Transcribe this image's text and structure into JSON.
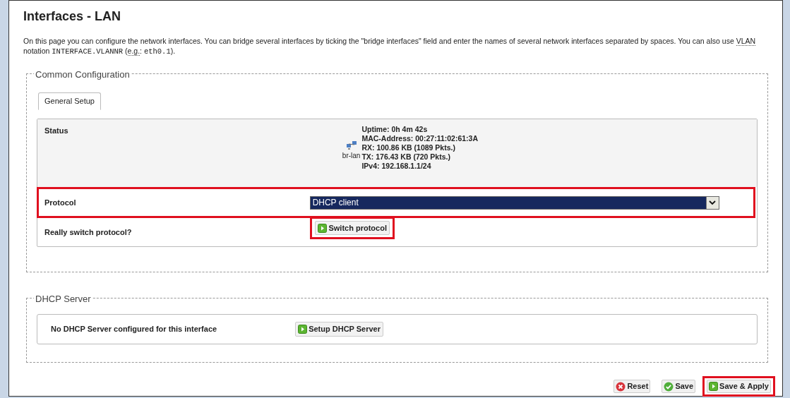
{
  "page": {
    "title": "Interfaces - LAN",
    "description": [
      {
        "kind": "text",
        "text": "On this page you can configure the network interfaces. You can bridge several interfaces by ticking the \"bridge interfaces\" field and enter the names of several network interfaces separated by spaces. You can also use "
      },
      {
        "kind": "abbr",
        "text": "VLAN"
      },
      {
        "kind": "text",
        "text": " notation "
      },
      {
        "kind": "code",
        "text": "INTERFACE.VLANNR"
      },
      {
        "kind": "text",
        "text": " ("
      },
      {
        "kind": "abbr",
        "text": "e.g."
      },
      {
        "kind": "text",
        "text": ": "
      },
      {
        "kind": "code",
        "text": "eth0.1"
      },
      {
        "kind": "text",
        "text": ")."
      }
    ]
  },
  "common_configuration": {
    "legend": "Common Configuration",
    "tabs": [
      {
        "label": "General Setup",
        "selected": true
      }
    ],
    "status": {
      "label": "Status",
      "device": "br-lan",
      "lines": [
        "Uptime: 0h 4m 42s",
        "MAC-Address: 00:27:11:02:61:3A",
        "RX: 100.86 KB (1089 Pkts.)",
        "TX: 176.43 KB (720 Pkts.)",
        "IPv4: 192.168.1.1/24"
      ]
    },
    "protocol": {
      "label": "Protocol",
      "value": "DHCP client",
      "highlighted": true
    },
    "switch": {
      "label": "Really switch protocol?",
      "button": "Switch protocol",
      "highlighted": true
    }
  },
  "dhcp_server": {
    "legend": "DHCP Server",
    "message": "No DHCP Server configured for this interface",
    "button": "Setup DHCP Server"
  },
  "actions": [
    {
      "kind": "reset",
      "label": "Reset",
      "highlighted": false
    },
    {
      "kind": "save",
      "label": "Save",
      "highlighted": false
    },
    {
      "kind": "apply",
      "label": "Save & Apply",
      "highlighted": true
    }
  ]
}
